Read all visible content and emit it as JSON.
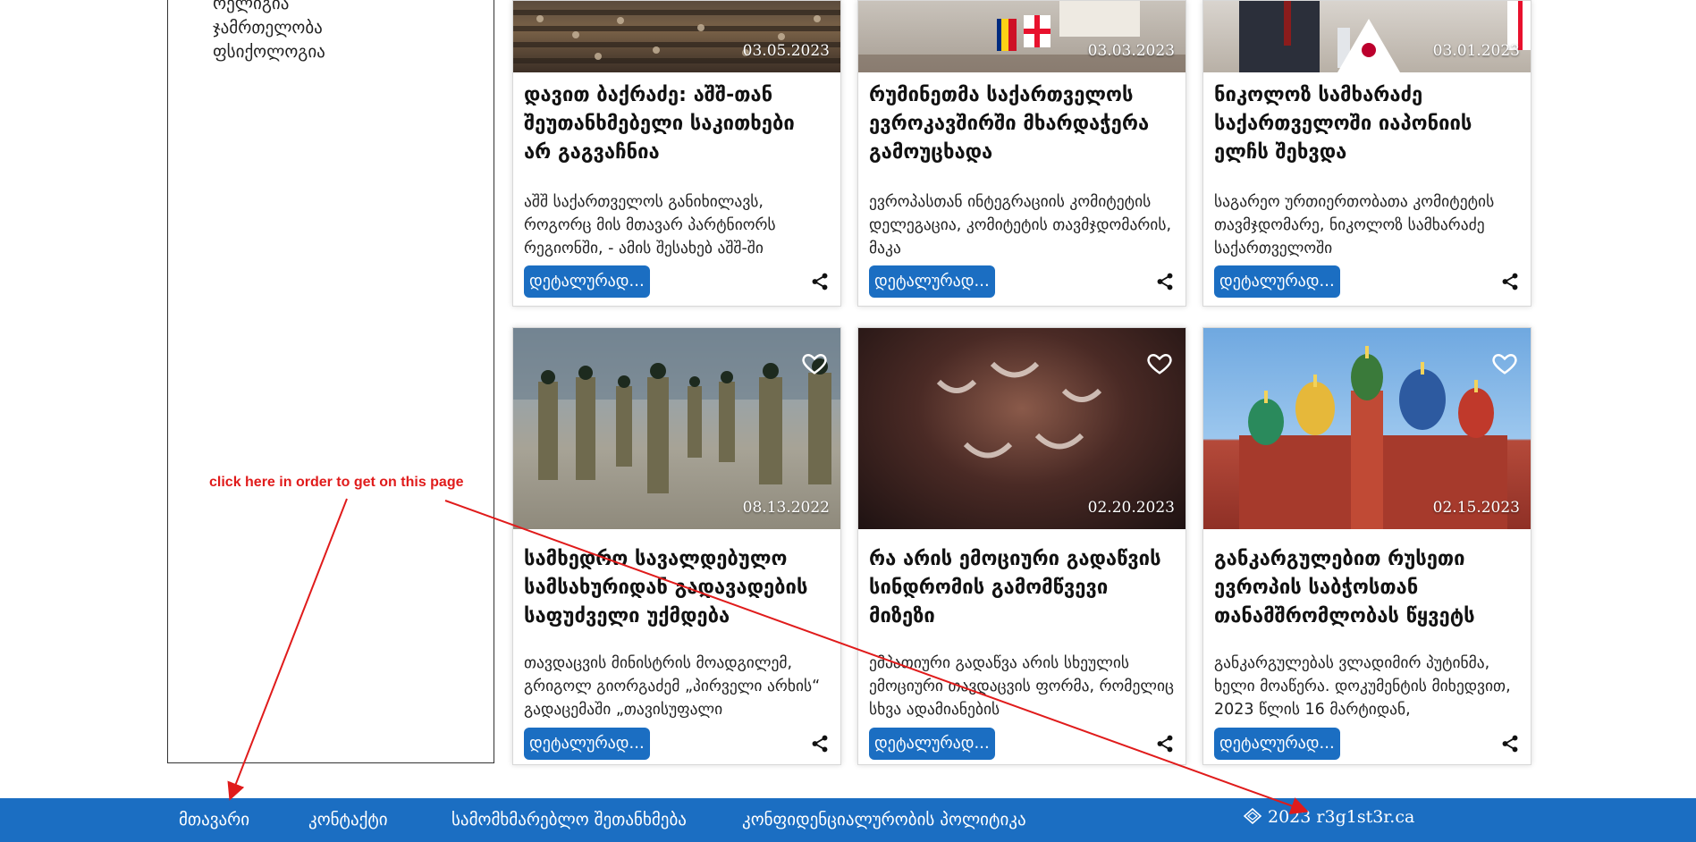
{
  "sidebar": {
    "items": [
      "რელიგია",
      "ჯამრთელობა",
      "ფსიქოლოგია"
    ]
  },
  "cards": [
    {
      "date": "03.05.2023",
      "title": "დავით ბაქრაძე: აშშ-თან შეუთანხმებელი საკითხები არ გაგვაჩნია",
      "desc": "აშშ საქართველოს განიხილავს, როგორც მის მთავარ პარტნიორს რეგიონში, - ამის შესახებ აშშ-ში",
      "button": "დეტალურად..."
    },
    {
      "date": "03.03.2023",
      "title": "რუმინეთმა საქართველოს ევროკავშირში მხარდაჭერა გამოუცხადა",
      "desc": "ევროპასთან ინტეგრაციის კომიტეტის დელეგაცია, კომიტეტის თავმჯდომარის, მაკა",
      "button": "დეტალურად..."
    },
    {
      "date": "03.01.2023",
      "title": "ნიკოლოზ სამხარაძე საქართველოში იაპონიის ელჩს შეხვდა",
      "desc": "საგარეო ურთიერთობათა კომიტეტის თავმჯდომარე, ნიკოლოზ სამხარაძე საქართველოში",
      "button": "დეტალურად..."
    },
    {
      "date": "08.13.2022",
      "title": "სამხედრო სავალდებულო სამსახურიდან გადავადების საფუძველი უქმდება",
      "desc": "თავდაცვის მინისტრის მოადგილემ, გრიგოლ გიორგაძემ „პირველი არხის“ გადაცემაში „თავისუფალი",
      "button": "დეტალურად..."
    },
    {
      "date": "02.20.2023",
      "title": "რა არის ემოციური გადაწვის სინდრომის გამომწვევი მიზეზი",
      "desc": "ემპათიური გადაწვა არის სხეულის ემოციური თავდაცვის ფორმა, რომელიც სხვა ადამიანების",
      "button": "დეტალურად..."
    },
    {
      "date": "02.15.2023",
      "title": "განკარგულებით რუსეთი ევროპის საბჭოსთან თანამშრომლობას წყვეტს",
      "desc": "განკარგულებას ვლადიმირ პუტინმა, ხელი მოაწერა. დოკუმენტის მიხედვით, 2023 წლის 16 მარტიდან,",
      "button": "დეტალურად..."
    }
  ],
  "icons": {
    "heart": "heart-icon",
    "share": "share-icon",
    "brand": "diamond-logo-icon"
  },
  "footer": {
    "links": [
      "მთავარი",
      "კონტაქტი",
      "სამომხმარებლო შეთანხმება",
      "კონფიდენციალურობის პოლიტიკა"
    ],
    "brand": "2023 r3g1st3r.ca"
  },
  "annotation": {
    "text": "click here in order to get on this page",
    "color": "#e01b1b"
  },
  "colors": {
    "accent": "#1b6ec2"
  }
}
